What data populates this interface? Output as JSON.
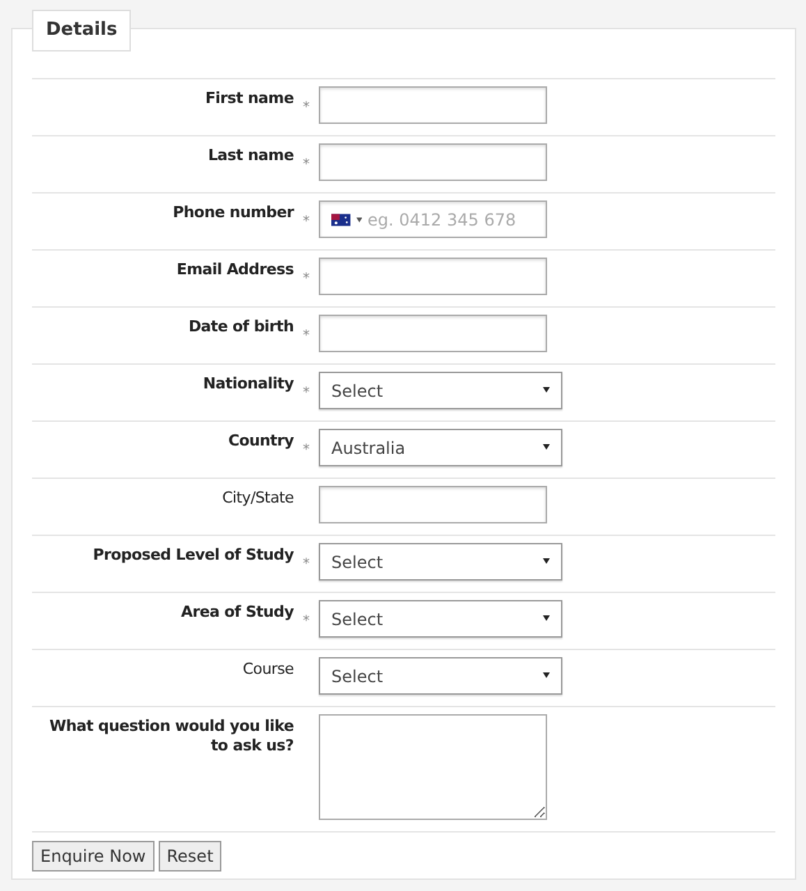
{
  "legend": "Details",
  "fields": [
    {
      "label": "First name",
      "mark": "*",
      "bold": true,
      "kind": "text"
    },
    {
      "label": "Last name",
      "mark": "*",
      "bold": true,
      "kind": "text"
    },
    {
      "label": "Phone number",
      "mark": "*",
      "bold": true,
      "kind": "phone",
      "placeholder": "eg. 0412 345 678"
    },
    {
      "label": "Email Address",
      "mark": "*",
      "bold": true,
      "kind": "text"
    },
    {
      "label": "Date of birth",
      "mark": "*",
      "bold": true,
      "kind": "text"
    },
    {
      "label": "Nationality",
      "mark": "*",
      "bold": true,
      "kind": "select",
      "value": "Select"
    },
    {
      "label": "Country",
      "mark": "*",
      "bold": true,
      "kind": "select",
      "value": "Australia"
    },
    {
      "label": "City/State",
      "bold": false,
      "kind": "text"
    },
    {
      "label": "Proposed Level of Study",
      "mark": "*",
      "bold": true,
      "kind": "select",
      "value": "Select"
    },
    {
      "label": "Area of Study",
      "mark": "*",
      "bold": true,
      "kind": "select",
      "value": "Select"
    },
    {
      "label": "Course",
      "bold": false,
      "kind": "select",
      "value": "Select"
    },
    {
      "label": "What question would you like to ask us?",
      "bold": true,
      "kind": "textarea"
    }
  ],
  "buttons": [
    "Enquire Now",
    "Reset"
  ]
}
